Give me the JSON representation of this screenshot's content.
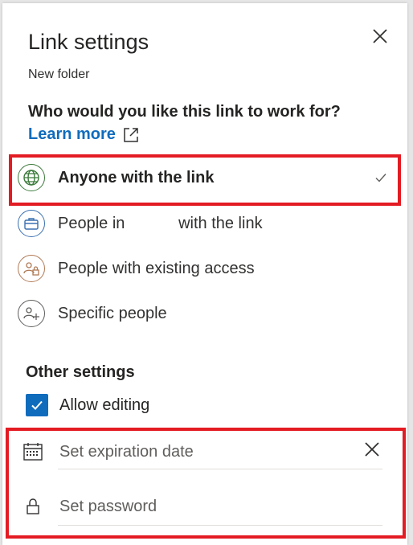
{
  "header": {
    "title": "Link settings",
    "subtitle": "New folder"
  },
  "share_scope": {
    "question": "Who would you like this link to work for?",
    "learn_more": "Learn more",
    "options": [
      {
        "label": "Anyone with the link",
        "icon": "globe-icon",
        "selected": true
      },
      {
        "label": "People in            with the link",
        "icon": "briefcase-icon",
        "selected": false
      },
      {
        "label": "People with existing access",
        "icon": "people-lock-icon",
        "selected": false
      },
      {
        "label": "Specific people",
        "icon": "add-people-icon",
        "selected": false
      }
    ]
  },
  "other_settings": {
    "heading": "Other settings",
    "allow_editing_label": "Allow editing",
    "allow_editing_checked": true,
    "expiration_placeholder": "Set expiration date",
    "password_placeholder": "Set password"
  },
  "colors": {
    "accent": "#0f6cbd",
    "highlight": "#e31b23",
    "globe": "#3b7a3b",
    "briefcase": "#3a70b0",
    "people_lock": "#b07a55"
  }
}
